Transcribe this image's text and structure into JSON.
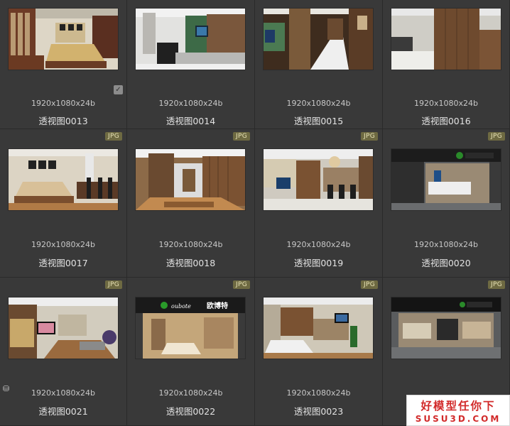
{
  "app": {
    "accent_badge": "#6e6a42",
    "check_icon": "check-icon",
    "db_icon": "database-icon"
  },
  "items": [
    {
      "name": "透视图0013",
      "info": "1920x1080x24b",
      "badge": "",
      "checked": true,
      "db": false,
      "scene": "bedroom"
    },
    {
      "name": "透视图0014",
      "info": "1920x1080x24b",
      "badge": "",
      "checked": false,
      "db": false,
      "scene": "living"
    },
    {
      "name": "透视图0015",
      "info": "1920x1080x24b",
      "badge": "",
      "checked": false,
      "db": false,
      "scene": "corridor"
    },
    {
      "name": "透视图0016",
      "info": "1920x1080x24b",
      "badge": "",
      "checked": false,
      "db": false,
      "scene": "cabinet"
    },
    {
      "name": "透视图0017",
      "info": "1920x1080x24b",
      "badge": "JPG",
      "checked": false,
      "db": false,
      "scene": "bedroom2"
    },
    {
      "name": "透视图0018",
      "info": "1920x1080x24b",
      "badge": "JPG",
      "checked": false,
      "db": false,
      "scene": "corridor2"
    },
    {
      "name": "透视图0019",
      "info": "1920x1080x24b",
      "badge": "JPG",
      "checked": false,
      "db": false,
      "scene": "dining"
    },
    {
      "name": "透视图0020",
      "info": "1920x1080x24b",
      "badge": "JPG",
      "checked": false,
      "db": false,
      "scene": "shopfront"
    },
    {
      "name": "透视图0021",
      "info": "1920x1080x24b",
      "badge": "JPG",
      "checked": false,
      "db": true,
      "scene": "lounge"
    },
    {
      "name": "透视图0022",
      "info": "1920x1080x24b",
      "badge": "JPG",
      "checked": false,
      "db": false,
      "scene": "store"
    },
    {
      "name": "透视图0023",
      "info": "1920x1080x24b",
      "badge": "JPG",
      "checked": false,
      "db": false,
      "scene": "bedroom3"
    },
    {
      "name": "",
      "info": "",
      "badge": "JPG",
      "checked": false,
      "db": false,
      "scene": "store2"
    }
  ],
  "store_sign": {
    "script": "oubote",
    "brand": "欧博特"
  },
  "watermark": {
    "line1": "好模型任你下",
    "line2": "SUSU3D.COM"
  }
}
